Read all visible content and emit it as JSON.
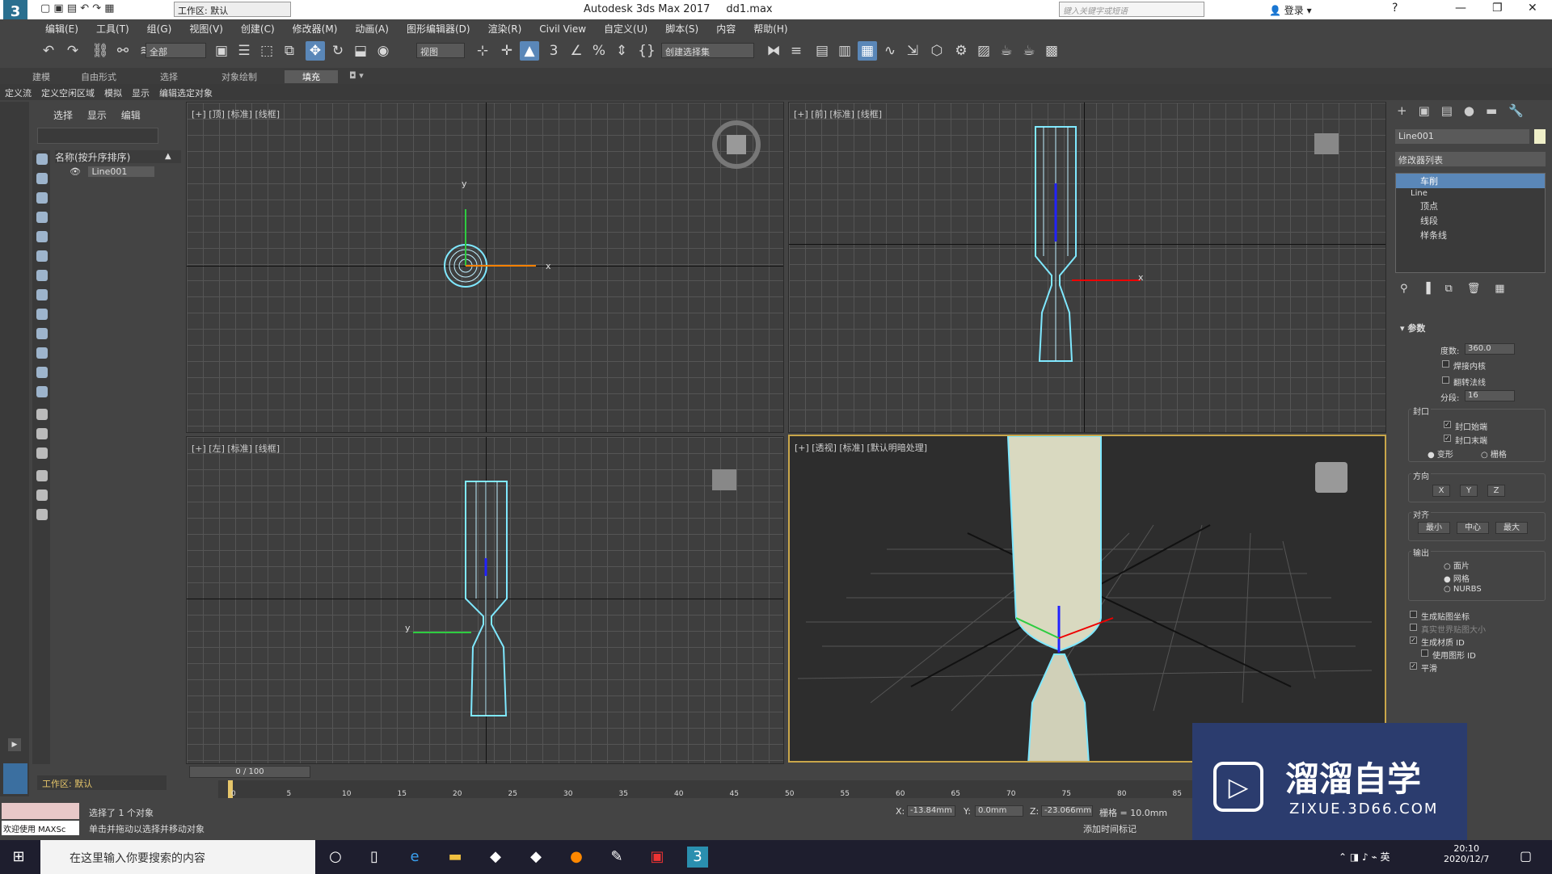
{
  "title": {
    "app": "Autodesk 3ds Max 2017",
    "file": "dd1.max",
    "workspace": "工作区: 默认",
    "search_placeholder": "键入关键字或短语",
    "login": "登录"
  },
  "menu": [
    "编辑(E)",
    "工具(T)",
    "组(G)",
    "视图(V)",
    "创建(C)",
    "修改器(M)",
    "动画(A)",
    "图形编辑器(D)",
    "渲染(R)",
    "Civil View",
    "自定义(U)",
    "脚本(S)",
    "内容",
    "帮助(H)"
  ],
  "toolbar": {
    "filter": "全部",
    "view": "视图",
    "selset": "创建选择集"
  },
  "ribbon_tabs": [
    "建模",
    "自由形式",
    "选择",
    "对象绘制",
    "填充"
  ],
  "ribbon_sub": [
    "定义流",
    "定义空闲区域",
    "模拟",
    "显示",
    "编辑选定对象"
  ],
  "scene_explorer": {
    "tabs": [
      "选择",
      "显示",
      "编辑"
    ],
    "header": "名称(按升序排序)",
    "item": "Line001",
    "workspace": "工作区: 默认"
  },
  "viewports": [
    {
      "label": "[+] [顶] [标准] [线框]"
    },
    {
      "label": "[+] [前] [标准] [线框]"
    },
    {
      "label": "[+] [左] [标准] [线框]"
    },
    {
      "label": "[+] [透视] [标准] [默认明暗处理]"
    }
  ],
  "modify_panel": {
    "object_name": "Line001",
    "modifier_list": "修改器列表",
    "stack": [
      "车削",
      "Line",
      "顶点",
      "线段",
      "样条线"
    ],
    "rollout": "参数",
    "degrees_label": "度数:",
    "degrees": "360.0",
    "weld_core": "焊接内核",
    "flip_normals": "翻转法线",
    "segments_label": "分段:",
    "segments": "16",
    "capping": "封口",
    "cap_start": "封口始端",
    "cap_end": "封口末端",
    "morph": "变形",
    "grid": "栅格",
    "direction": "方向",
    "dir_x": "X",
    "dir_y": "Y",
    "dir_z": "Z",
    "align": "对齐",
    "min": "最小",
    "center": "中心",
    "max": "最大",
    "output": "输出",
    "patch": "面片",
    "mesh": "网格",
    "nurbs": "NURBS",
    "gen_map": "生成贴图坐标",
    "real_world": "真实世界贴图大小",
    "gen_mat": "生成材质 ID",
    "use_shape": "使用图形 ID",
    "smooth": "平滑"
  },
  "timeline": {
    "frame": "0 / 100",
    "ticks": [
      "0",
      "5",
      "10",
      "15",
      "20",
      "25",
      "30",
      "35",
      "40",
      "45",
      "50",
      "55",
      "60",
      "65",
      "70",
      "75",
      "80",
      "85"
    ]
  },
  "status": {
    "maxscript": "欢迎使用 MAXSc",
    "selected": "选择了 1 个对象",
    "hint": "单击并拖动以选择并移动对象",
    "x_label": "X:",
    "x": "-13.84mm",
    "y_label": "Y:",
    "y": "0.0mm",
    "z_label": "Z:",
    "z": "-23.066mm",
    "grid": "栅格 = 10.0mm",
    "add_time_tag": "添加时间标记"
  },
  "taskbar": {
    "search": "在这里输入你要搜索的内容",
    "time": "20:10",
    "date": "2020/12/7",
    "ime": "英"
  },
  "watermark": {
    "brand": "溜溜自学",
    "url": "ZIXUE.3D66.COM"
  }
}
